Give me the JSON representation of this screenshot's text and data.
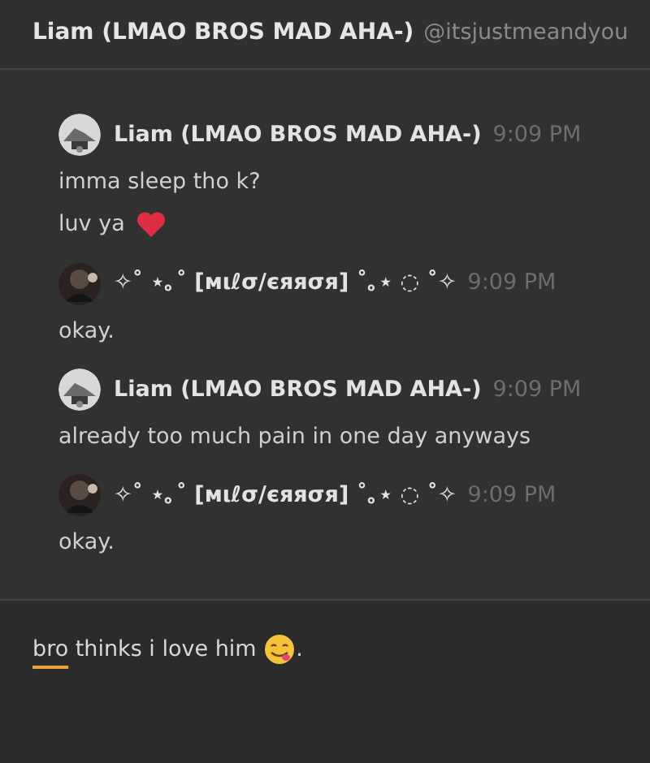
{
  "header": {
    "title": "Liam (LMAO BROS MAD AHA-)",
    "handle": "@itsjustmeandyou"
  },
  "messages": [
    {
      "author": "Liam (LMAO BROS MAD AHA-)",
      "kind": "light",
      "time": "9:09 PM",
      "lines": [
        {
          "text": "imma sleep tho k?",
          "kind": "plain"
        },
        {
          "text": "luv ya",
          "kind": "with_emoji"
        }
      ]
    },
    {
      "author": "✧˚ ⋆｡˚ [мιℓσ/єяяσя] ˚｡⋆ ◌ ˚✧",
      "kind": "dark",
      "time": "9:09 PM",
      "lines": [
        {
          "text": "okay.",
          "kind": "plain"
        }
      ]
    },
    {
      "author": "Liam (LMAO BROS MAD AHA-)",
      "kind": "light",
      "time": "9:09 PM",
      "lines": [
        {
          "text": "already too much pain in one day anyways",
          "kind": "plain"
        }
      ]
    },
    {
      "author": "✧˚ ⋆｡˚ [мιℓσ/єяяσя] ˚｡⋆ ◌ ˚✧",
      "kind": "dark",
      "time": "9:09 PM",
      "lines": [
        {
          "text": "okay.",
          "kind": "plain"
        }
      ]
    }
  ],
  "composer": {
    "words": [
      {
        "text": "bro",
        "flagged": true
      },
      {
        "text": " thinks i love him ",
        "flagged": false
      }
    ],
    "suffix": "."
  }
}
